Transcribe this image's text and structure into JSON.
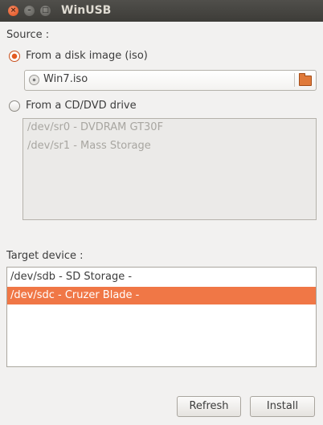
{
  "window": {
    "title": "WinUSB",
    "close_glyph": "×",
    "minimize_glyph": "–",
    "maximize_glyph": "□"
  },
  "source": {
    "label": "Source :",
    "disk_image_option": "From a disk image (iso)",
    "disk_image_selected": true,
    "file_chooser_value": "Win7.iso",
    "cd_dvd_option": "From a CD/DVD drive",
    "cd_dvd_selected": false,
    "cd_drives": [
      "/dev/sr0 - DVDRAM GT30F",
      "/dev/sr1 - Mass Storage"
    ]
  },
  "target": {
    "label": "Target device :",
    "devices": [
      "/dev/sdb - SD Storage -",
      "/dev/sdc - Cruzer Blade -"
    ],
    "selected_index": 1
  },
  "buttons": {
    "refresh": "Refresh",
    "install": "Install"
  },
  "colors": {
    "accent": "#f07746",
    "titlebar": "#3d3c38",
    "background": "#f2f1f0"
  }
}
